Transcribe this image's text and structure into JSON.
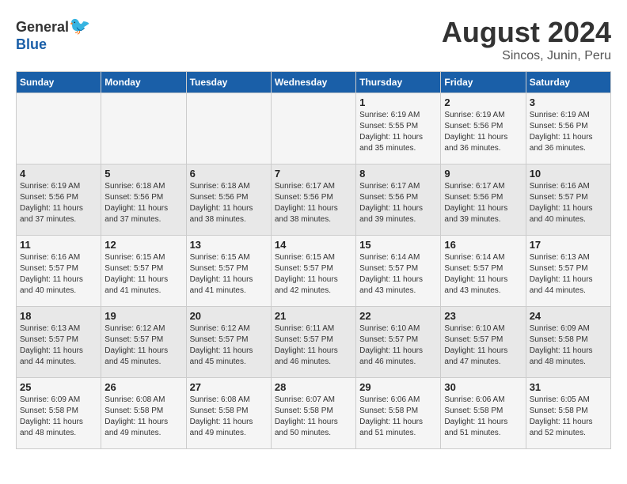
{
  "header": {
    "logo": {
      "general": "General",
      "blue": "Blue"
    },
    "month_year": "August 2024",
    "location": "Sincos, Junin, Peru"
  },
  "weekdays": [
    "Sunday",
    "Monday",
    "Tuesday",
    "Wednesday",
    "Thursday",
    "Friday",
    "Saturday"
  ],
  "weeks": [
    [
      {
        "day": "",
        "sunrise": "",
        "sunset": "",
        "daylight": ""
      },
      {
        "day": "",
        "sunrise": "",
        "sunset": "",
        "daylight": ""
      },
      {
        "day": "",
        "sunrise": "",
        "sunset": "",
        "daylight": ""
      },
      {
        "day": "",
        "sunrise": "",
        "sunset": "",
        "daylight": ""
      },
      {
        "day": "1",
        "sunrise": "Sunrise: 6:19 AM",
        "sunset": "Sunset: 5:55 PM",
        "daylight": "Daylight: 11 hours and 35 minutes."
      },
      {
        "day": "2",
        "sunrise": "Sunrise: 6:19 AM",
        "sunset": "Sunset: 5:56 PM",
        "daylight": "Daylight: 11 hours and 36 minutes."
      },
      {
        "day": "3",
        "sunrise": "Sunrise: 6:19 AM",
        "sunset": "Sunset: 5:56 PM",
        "daylight": "Daylight: 11 hours and 36 minutes."
      }
    ],
    [
      {
        "day": "4",
        "sunrise": "Sunrise: 6:19 AM",
        "sunset": "Sunset: 5:56 PM",
        "daylight": "Daylight: 11 hours and 37 minutes."
      },
      {
        "day": "5",
        "sunrise": "Sunrise: 6:18 AM",
        "sunset": "Sunset: 5:56 PM",
        "daylight": "Daylight: 11 hours and 37 minutes."
      },
      {
        "day": "6",
        "sunrise": "Sunrise: 6:18 AM",
        "sunset": "Sunset: 5:56 PM",
        "daylight": "Daylight: 11 hours and 38 minutes."
      },
      {
        "day": "7",
        "sunrise": "Sunrise: 6:17 AM",
        "sunset": "Sunset: 5:56 PM",
        "daylight": "Daylight: 11 hours and 38 minutes."
      },
      {
        "day": "8",
        "sunrise": "Sunrise: 6:17 AM",
        "sunset": "Sunset: 5:56 PM",
        "daylight": "Daylight: 11 hours and 39 minutes."
      },
      {
        "day": "9",
        "sunrise": "Sunrise: 6:17 AM",
        "sunset": "Sunset: 5:56 PM",
        "daylight": "Daylight: 11 hours and 39 minutes."
      },
      {
        "day": "10",
        "sunrise": "Sunrise: 6:16 AM",
        "sunset": "Sunset: 5:57 PM",
        "daylight": "Daylight: 11 hours and 40 minutes."
      }
    ],
    [
      {
        "day": "11",
        "sunrise": "Sunrise: 6:16 AM",
        "sunset": "Sunset: 5:57 PM",
        "daylight": "Daylight: 11 hours and 40 minutes."
      },
      {
        "day": "12",
        "sunrise": "Sunrise: 6:15 AM",
        "sunset": "Sunset: 5:57 PM",
        "daylight": "Daylight: 11 hours and 41 minutes."
      },
      {
        "day": "13",
        "sunrise": "Sunrise: 6:15 AM",
        "sunset": "Sunset: 5:57 PM",
        "daylight": "Daylight: 11 hours and 41 minutes."
      },
      {
        "day": "14",
        "sunrise": "Sunrise: 6:15 AM",
        "sunset": "Sunset: 5:57 PM",
        "daylight": "Daylight: 11 hours and 42 minutes."
      },
      {
        "day": "15",
        "sunrise": "Sunrise: 6:14 AM",
        "sunset": "Sunset: 5:57 PM",
        "daylight": "Daylight: 11 hours and 43 minutes."
      },
      {
        "day": "16",
        "sunrise": "Sunrise: 6:14 AM",
        "sunset": "Sunset: 5:57 PM",
        "daylight": "Daylight: 11 hours and 43 minutes."
      },
      {
        "day": "17",
        "sunrise": "Sunrise: 6:13 AM",
        "sunset": "Sunset: 5:57 PM",
        "daylight": "Daylight: 11 hours and 44 minutes."
      }
    ],
    [
      {
        "day": "18",
        "sunrise": "Sunrise: 6:13 AM",
        "sunset": "Sunset: 5:57 PM",
        "daylight": "Daylight: 11 hours and 44 minutes."
      },
      {
        "day": "19",
        "sunrise": "Sunrise: 6:12 AM",
        "sunset": "Sunset: 5:57 PM",
        "daylight": "Daylight: 11 hours and 45 minutes."
      },
      {
        "day": "20",
        "sunrise": "Sunrise: 6:12 AM",
        "sunset": "Sunset: 5:57 PM",
        "daylight": "Daylight: 11 hours and 45 minutes."
      },
      {
        "day": "21",
        "sunrise": "Sunrise: 6:11 AM",
        "sunset": "Sunset: 5:57 PM",
        "daylight": "Daylight: 11 hours and 46 minutes."
      },
      {
        "day": "22",
        "sunrise": "Sunrise: 6:10 AM",
        "sunset": "Sunset: 5:57 PM",
        "daylight": "Daylight: 11 hours and 46 minutes."
      },
      {
        "day": "23",
        "sunrise": "Sunrise: 6:10 AM",
        "sunset": "Sunset: 5:57 PM",
        "daylight": "Daylight: 11 hours and 47 minutes."
      },
      {
        "day": "24",
        "sunrise": "Sunrise: 6:09 AM",
        "sunset": "Sunset: 5:58 PM",
        "daylight": "Daylight: 11 hours and 48 minutes."
      }
    ],
    [
      {
        "day": "25",
        "sunrise": "Sunrise: 6:09 AM",
        "sunset": "Sunset: 5:58 PM",
        "daylight": "Daylight: 11 hours and 48 minutes."
      },
      {
        "day": "26",
        "sunrise": "Sunrise: 6:08 AM",
        "sunset": "Sunset: 5:58 PM",
        "daylight": "Daylight: 11 hours and 49 minutes."
      },
      {
        "day": "27",
        "sunrise": "Sunrise: 6:08 AM",
        "sunset": "Sunset: 5:58 PM",
        "daylight": "Daylight: 11 hours and 49 minutes."
      },
      {
        "day": "28",
        "sunrise": "Sunrise: 6:07 AM",
        "sunset": "Sunset: 5:58 PM",
        "daylight": "Daylight: 11 hours and 50 minutes."
      },
      {
        "day": "29",
        "sunrise": "Sunrise: 6:06 AM",
        "sunset": "Sunset: 5:58 PM",
        "daylight": "Daylight: 11 hours and 51 minutes."
      },
      {
        "day": "30",
        "sunrise": "Sunrise: 6:06 AM",
        "sunset": "Sunset: 5:58 PM",
        "daylight": "Daylight: 11 hours and 51 minutes."
      },
      {
        "day": "31",
        "sunrise": "Sunrise: 6:05 AM",
        "sunset": "Sunset: 5:58 PM",
        "daylight": "Daylight: 11 hours and 52 minutes."
      }
    ]
  ]
}
